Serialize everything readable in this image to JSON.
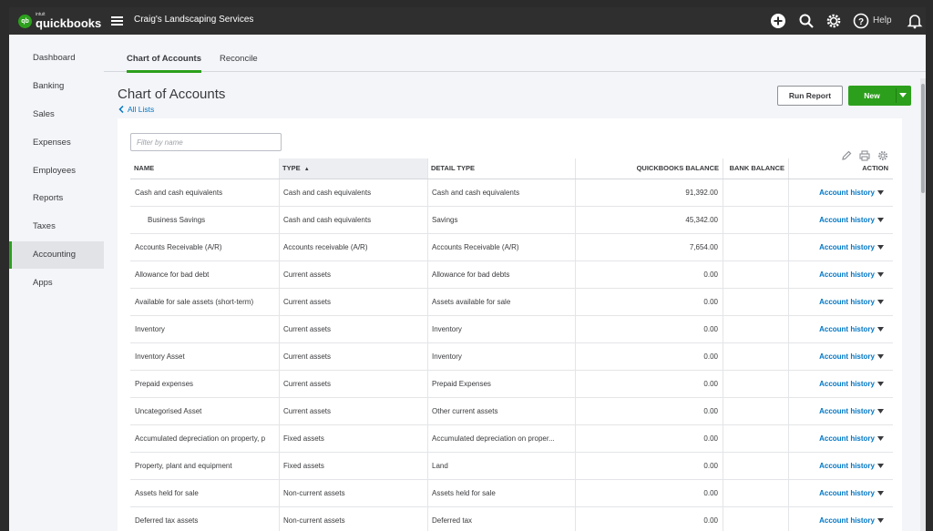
{
  "app": {
    "logo_small": "intuit",
    "logo_big": "quickbooks",
    "logo_mark": "qb",
    "company": "Craig's Landscaping Services",
    "help_label": "Help"
  },
  "sidebar": {
    "items": [
      {
        "label": "Dashboard"
      },
      {
        "label": "Banking"
      },
      {
        "label": "Sales"
      },
      {
        "label": "Expenses"
      },
      {
        "label": "Employees"
      },
      {
        "label": "Reports"
      },
      {
        "label": "Taxes"
      },
      {
        "label": "Accounting",
        "active": true
      },
      {
        "label": "Apps"
      }
    ]
  },
  "tabs": [
    {
      "label": "Chart of Accounts",
      "active": true
    },
    {
      "label": "Reconcile"
    }
  ],
  "page": {
    "title": "Chart of Accounts",
    "back_link": "All Lists",
    "run_report": "Run Report",
    "new_button": "New",
    "filter_placeholder": "Filter by name"
  },
  "table": {
    "columns": {
      "name": "NAME",
      "type": "TYPE",
      "type_sort_icon": "▲",
      "detail": "DETAIL TYPE",
      "qb_balance": "QUICKBOOKS BALANCE",
      "bank_balance": "BANK BALANCE",
      "action": "ACTION"
    },
    "action_label": "Account history",
    "rows": [
      {
        "name": "Cash and cash equivalents",
        "type": "Cash and cash equivalents",
        "detail": "Cash and cash equivalents",
        "balance": "91,392.00",
        "bank": "",
        "indent": false
      },
      {
        "name": "Business Savings",
        "type": "Cash and cash equivalents",
        "detail": "Savings",
        "balance": "45,342.00",
        "bank": "",
        "indent": true
      },
      {
        "name": "Accounts Receivable (A/R)",
        "type": "Accounts receivable (A/R)",
        "detail": "Accounts Receivable (A/R)",
        "balance": "7,654.00",
        "bank": "",
        "indent": false
      },
      {
        "name": "Allowance for bad debt",
        "type": "Current assets",
        "detail": "Allowance for bad debts",
        "balance": "0.00",
        "bank": "",
        "indent": false
      },
      {
        "name": "Available for sale assets (short-term)",
        "type": "Current assets",
        "detail": "Assets available for sale",
        "balance": "0.00",
        "bank": "",
        "indent": false
      },
      {
        "name": "Inventory",
        "type": "Current assets",
        "detail": "Inventory",
        "balance": "0.00",
        "bank": "",
        "indent": false
      },
      {
        "name": "Inventory Asset",
        "type": "Current assets",
        "detail": "Inventory",
        "balance": "0.00",
        "bank": "",
        "indent": false
      },
      {
        "name": "Prepaid expenses",
        "type": "Current assets",
        "detail": "Prepaid Expenses",
        "balance": "0.00",
        "bank": "",
        "indent": false
      },
      {
        "name": "Uncategorised Asset",
        "type": "Current assets",
        "detail": "Other current assets",
        "balance": "0.00",
        "bank": "",
        "indent": false
      },
      {
        "name": "Accumulated depreciation on property, p",
        "type": "Fixed assets",
        "detail": "Accumulated depreciation on proper...",
        "balance": "0.00",
        "bank": "",
        "indent": false
      },
      {
        "name": "Property, plant and equipment",
        "type": "Fixed assets",
        "detail": "Land",
        "balance": "0.00",
        "bank": "",
        "indent": false
      },
      {
        "name": "Assets held for sale",
        "type": "Non-current assets",
        "detail": "Assets held for sale",
        "balance": "0.00",
        "bank": "",
        "indent": false
      },
      {
        "name": "Deferred tax assets",
        "type": "Non-current assets",
        "detail": "Deferred tax",
        "balance": "0.00",
        "bank": "",
        "indent": false
      }
    ]
  },
  "colors": {
    "brand_green": "#2ca01c",
    "link_blue": "#0077c5",
    "topbar": "#2f2f2f"
  }
}
